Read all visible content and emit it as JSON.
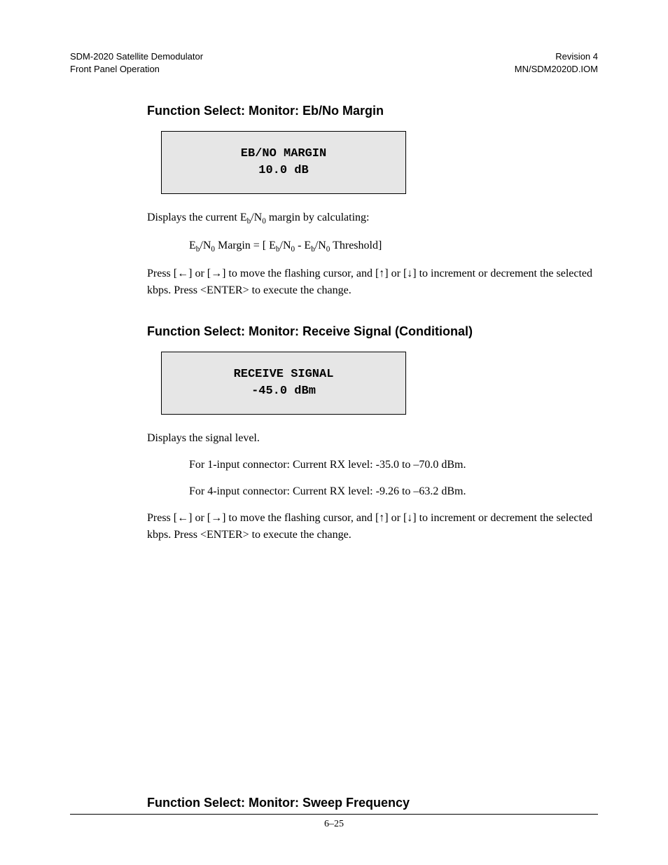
{
  "header": {
    "left_line1": "SDM-2020 Satellite Demodulator",
    "left_line2": "Front Panel Operation",
    "right_line1": "Revision 4",
    "right_line2": "MN/SDM2020D.IOM"
  },
  "section1": {
    "heading": "Function Select: Monitor: Eb/No Margin",
    "display_line1": "EB/NO MARGIN",
    "display_line2": "10.0 dB",
    "para1_prefix": "Displays the current  E",
    "para1_sub1": "b",
    "para1_mid1": "/N",
    "para1_sub2": "0",
    "para1_suffix": " margin by calculating:",
    "formula_prefix": "E",
    "formula_sub1": "b",
    "formula_mid1": "/N",
    "formula_sub2": "0",
    "formula_mid2": " Margin = [ E",
    "formula_sub3": "b",
    "formula_mid3": "/N",
    "formula_sub4": "0",
    "formula_mid4": " -  E",
    "formula_sub5": "b",
    "formula_mid5": "/N",
    "formula_sub6": "0",
    "formula_suffix": " Threshold]",
    "instruction_p1": "Press [",
    "arrow_left": "←",
    "instruction_p2": "] or [",
    "arrow_right": "→",
    "instruction_p3": "] to move the flashing cursor, and [",
    "arrow_up": "↑",
    "instruction_p4": "] or [",
    "arrow_down": "↓",
    "instruction_p5": "] to increment or decrement the selected kbps. Press <ENTER> to execute the change."
  },
  "section2": {
    "heading": "Function Select: Monitor: Receive Signal (Conditional)",
    "display_line1": "RECEIVE SIGNAL",
    "display_line2": "-45.0 dBm",
    "para1": "Displays the signal level.",
    "para2": "For 1-input connector: Current RX level: -35.0 to –70.0 dBm.",
    "para3": "For 4-input connector: Current RX level: -9.26 to –63.2 dBm.",
    "instruction_p1": "Press [",
    "arrow_left": "←",
    "instruction_p2": "] or [",
    "arrow_right": "→",
    "instruction_p3": "] to move the flashing cursor, and [",
    "arrow_up": "↑",
    "instruction_p4": "] or [",
    "arrow_down": "↓",
    "instruction_p5": "] to increment or decrement the selected kbps. Press <ENTER> to execute the change."
  },
  "section3": {
    "heading": "Function Select: Monitor: Sweep Frequency"
  },
  "footer": {
    "page": "6–25"
  }
}
